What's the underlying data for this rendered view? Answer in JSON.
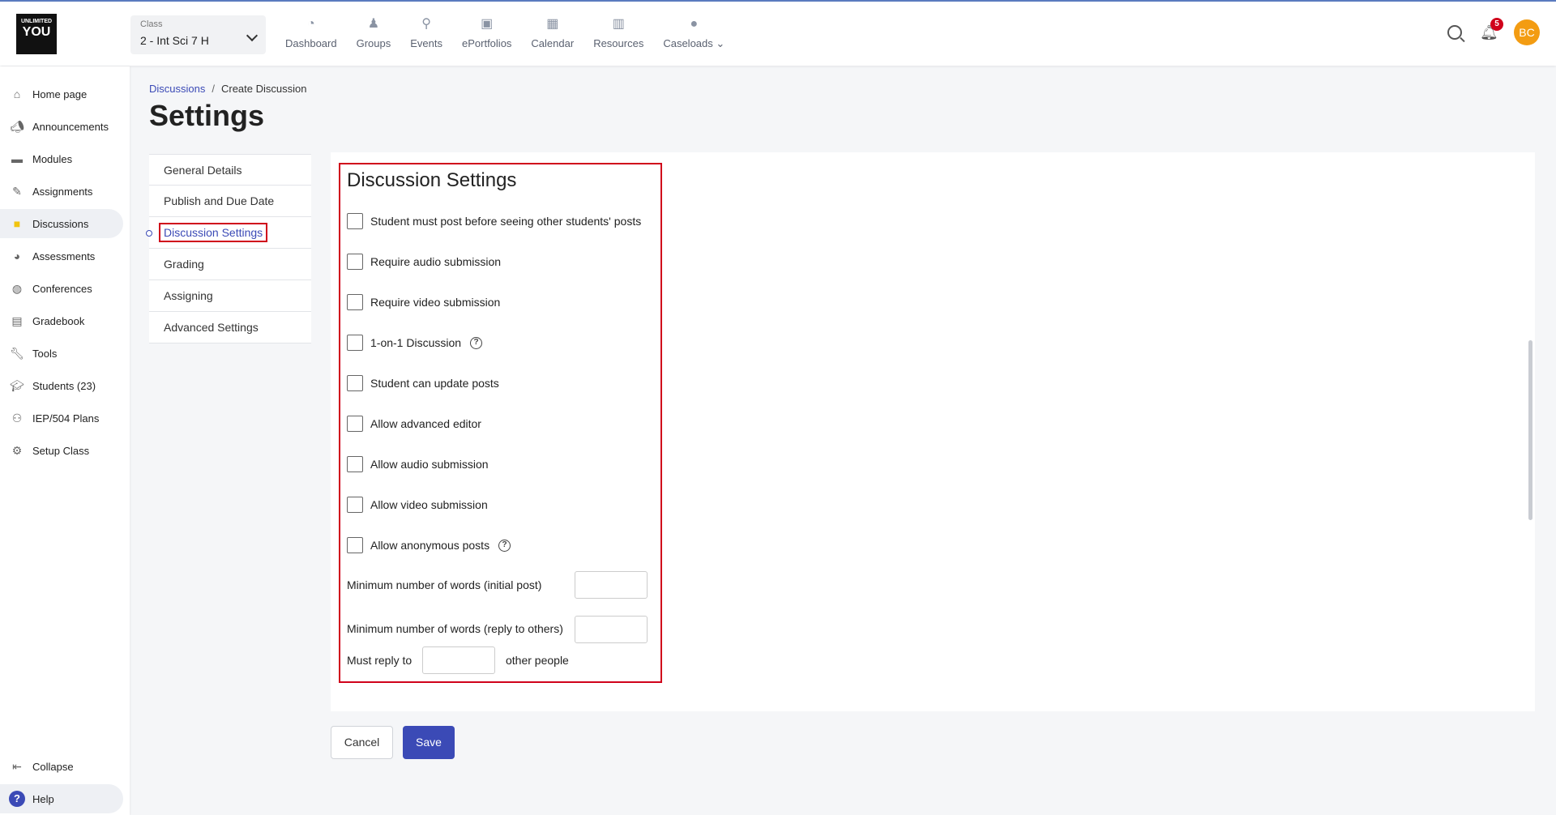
{
  "logo": {
    "line1": "UNLIMITED",
    "line2": "YOU"
  },
  "class_selector": {
    "label": "Class",
    "value": "2 - Int Sci 7 H"
  },
  "top_nav": [
    {
      "label": "Dashboard",
      "icon": "gauge-icon"
    },
    {
      "label": "Groups",
      "icon": "groups-icon"
    },
    {
      "label": "Events",
      "icon": "map-pin-icon"
    },
    {
      "label": "ePortfolios",
      "icon": "portfolio-icon"
    },
    {
      "label": "Calendar",
      "icon": "calendar-icon"
    },
    {
      "label": "Resources",
      "icon": "resources-icon"
    },
    {
      "label": "Caseloads",
      "icon": "person-icon"
    }
  ],
  "notifications": {
    "count": "5"
  },
  "user": {
    "initials": "BC"
  },
  "sidebar": {
    "items": [
      {
        "label": "Home page",
        "icon": "home-icon"
      },
      {
        "label": "Announcements",
        "icon": "megaphone-icon"
      },
      {
        "label": "Modules",
        "icon": "modules-icon"
      },
      {
        "label": "Assignments",
        "icon": "assignment-icon"
      },
      {
        "label": "Discussions",
        "icon": "discussion-icon"
      },
      {
        "label": "Assessments",
        "icon": "assessment-icon"
      },
      {
        "label": "Conferences",
        "icon": "conference-icon"
      },
      {
        "label": "Gradebook",
        "icon": "gradebook-icon"
      },
      {
        "label": "Tools",
        "icon": "wrench-icon"
      },
      {
        "label": "Students (23)",
        "icon": "students-icon"
      },
      {
        "label": "IEP/504 Plans",
        "icon": "plans-icon"
      },
      {
        "label": "Setup Class",
        "icon": "gear-icon"
      }
    ],
    "collapse_label": "Collapse",
    "help_label": "Help"
  },
  "breadcrumb": {
    "parent": "Discussions",
    "current": "Create Discussion"
  },
  "page_title": "Settings",
  "settings_nav": [
    "General Details",
    "Publish and Due Date",
    "Discussion Settings",
    "Grading",
    "Assigning",
    "Advanced Settings"
  ],
  "discussion_settings": {
    "title": "Discussion Settings",
    "checkboxes": [
      {
        "label": "Student must post before seeing other students' posts",
        "checked": false
      },
      {
        "label": "Require audio submission",
        "checked": false
      },
      {
        "label": "Require video submission",
        "checked": false
      },
      {
        "label": "1-on-1 Discussion",
        "checked": false,
        "help": true
      },
      {
        "label": "Student can update posts",
        "checked": false
      },
      {
        "label": "Allow advanced editor",
        "checked": false
      },
      {
        "label": "Allow audio submission",
        "checked": false
      },
      {
        "label": "Allow video submission",
        "checked": false
      },
      {
        "label": "Allow anonymous posts",
        "checked": false,
        "help": true
      }
    ],
    "min_words_initial_label": "Minimum number of words (initial post)",
    "min_words_initial_value": "",
    "min_words_reply_label": "Minimum number of words (reply to others)",
    "min_words_reply_value": "",
    "must_reply_prefix": "Must reply to",
    "must_reply_value": "",
    "must_reply_suffix": "other people"
  },
  "buttons": {
    "cancel": "Cancel",
    "save": "Save"
  },
  "colors": {
    "accent": "#3b4ab6",
    "highlight_border": "#d0021b",
    "badge": "#d0021b",
    "avatar": "#f39c12"
  }
}
